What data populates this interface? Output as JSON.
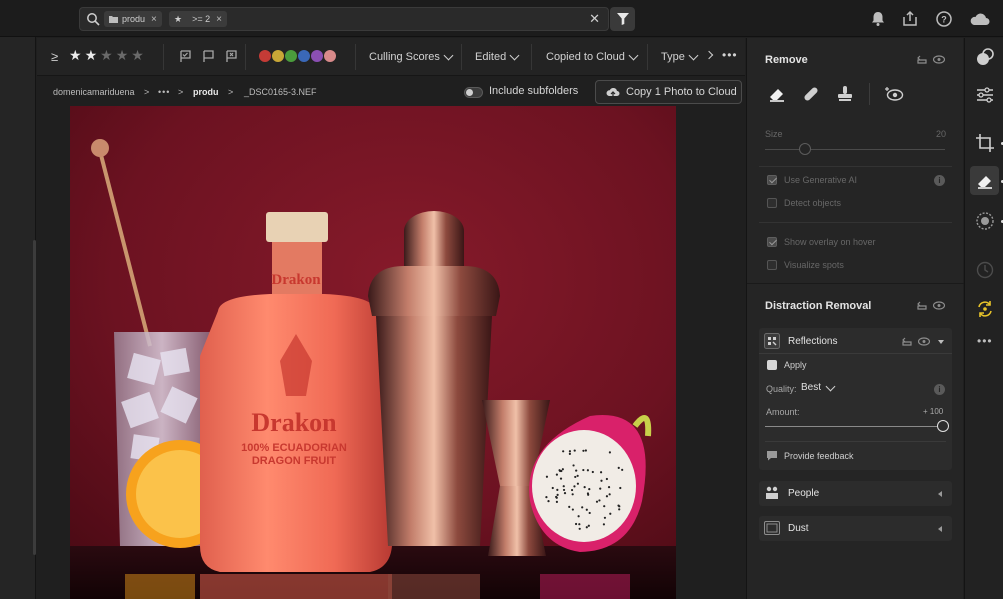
{
  "search": {
    "chips": [
      {
        "label": "produ",
        "icon": "folder-icon"
      },
      {
        "label": ">= 2",
        "icon": "star-icon"
      }
    ]
  },
  "filterbar": {
    "rating_operator": "≥",
    "stars_filled": 2,
    "stars_total": 5,
    "color_labels": [
      "#c53b36",
      "#c8a737",
      "#4a9c3c",
      "#3a68b8",
      "#8b4fb3",
      "#d88a8a"
    ],
    "dropdowns": [
      {
        "label": "Culling Scores"
      },
      {
        "label": "Edited"
      },
      {
        "label": "Copied to Cloud"
      },
      {
        "label": "Type"
      }
    ],
    "more": "•••"
  },
  "breadcrumb": {
    "root": "domenicamariduena",
    "ellipsis": "•••",
    "folder": "produ",
    "file": "_DSC0165-3.NEF",
    "include_subfolders": "Include subfolders",
    "copy_button": "Copy 1 Photo to Cloud"
  },
  "remove_panel": {
    "title": "Remove",
    "size_label": "Size",
    "size_value": "20",
    "size_fraction": 0.22,
    "use_generative_ai": "Use Generative AI",
    "detect_objects": "Detect objects",
    "show_overlay": "Show overlay on hover",
    "visualize_spots": "Visualize spots"
  },
  "distraction_removal": {
    "title": "Distraction Removal",
    "reflections": {
      "title": "Reflections",
      "apply": "Apply",
      "quality_label": "Quality:",
      "quality_value": "Best",
      "amount_label": "Amount:",
      "amount_value": "+ 100",
      "amount_fraction": 1.0,
      "feedback": "Provide feedback"
    },
    "people": "People",
    "dust": "Dust"
  },
  "colors": {
    "accent_yellow": "#e8c42a",
    "panel_bg": "#252525",
    "photo_bg": "#6e1320"
  }
}
